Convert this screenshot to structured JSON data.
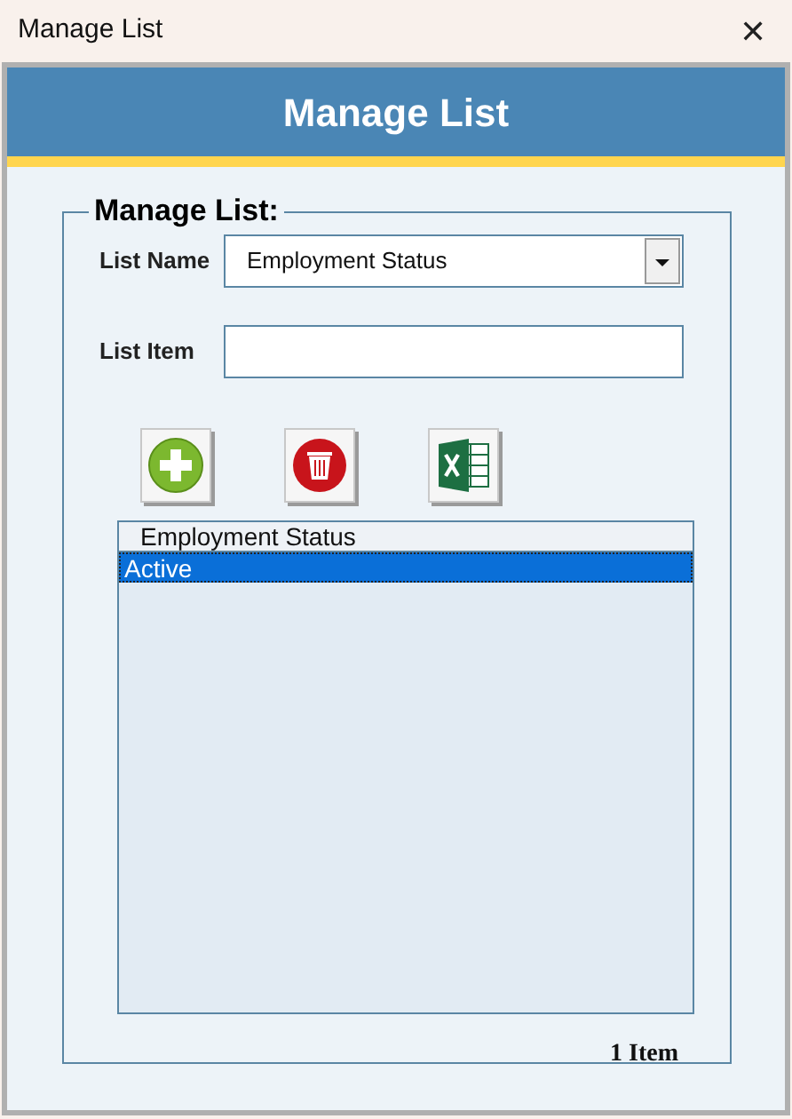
{
  "window": {
    "title": "Manage List",
    "close": "✕"
  },
  "header": {
    "title": "Manage List"
  },
  "group": {
    "legend": "Manage List:",
    "list_name": {
      "label": "List Name",
      "value": "Employment Status"
    },
    "list_item": {
      "label": "List Item"
    },
    "buttons": [
      {
        "kind": "add"
      },
      {
        "kind": "delete"
      },
      {
        "kind": "excel"
      }
    ],
    "listbox": {
      "items": [
        {
          "text": "Employment Status",
          "selected": false
        },
        {
          "text": "Active",
          "selected": true
        }
      ]
    },
    "count": "1 Item"
  }
}
